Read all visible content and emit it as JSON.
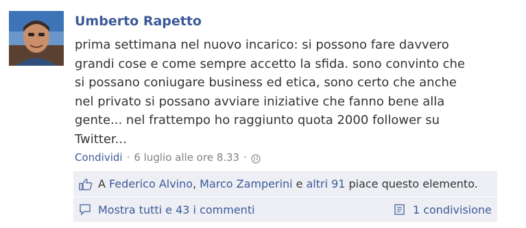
{
  "post": {
    "author": "Umberto Rapetto",
    "message_lines": [
      "prima settimana nel nuovo incarico: si possono fare davvero",
      "grandi cose e come sempre accetto la sfida. sono convinto che",
      "si possano coniugare business ed etica, sono certo che anche",
      "nel privato si possano avviare iniziative che fanno bene alla",
      "gente... nel frattempo ho raggiunto quota 2000 follower su",
      "Twitter..."
    ],
    "share_label": "Condividi",
    "separator": "·",
    "timestamp": "6 luglio alle ore 8.33"
  },
  "likes": {
    "prefix": "A",
    "user1": "Federico Alvino",
    "comma": ",",
    "user2": "Marco Zamperini",
    "and": "e",
    "others": "altri 91",
    "suffix": "piace questo elemento."
  },
  "comments": {
    "label": "Mostra tutti e 43 i commenti",
    "shares": "1 condivisione"
  },
  "icons": {
    "avatar": "profile-photo",
    "privacy": "globe-icon",
    "like": "thumbs-up-icon",
    "comment": "comment-bubble-icon",
    "share": "share-icon"
  },
  "colors": {
    "link": "#3b5998",
    "text": "#333333",
    "meta": "#808080",
    "ufi_background": "#edeff4"
  }
}
